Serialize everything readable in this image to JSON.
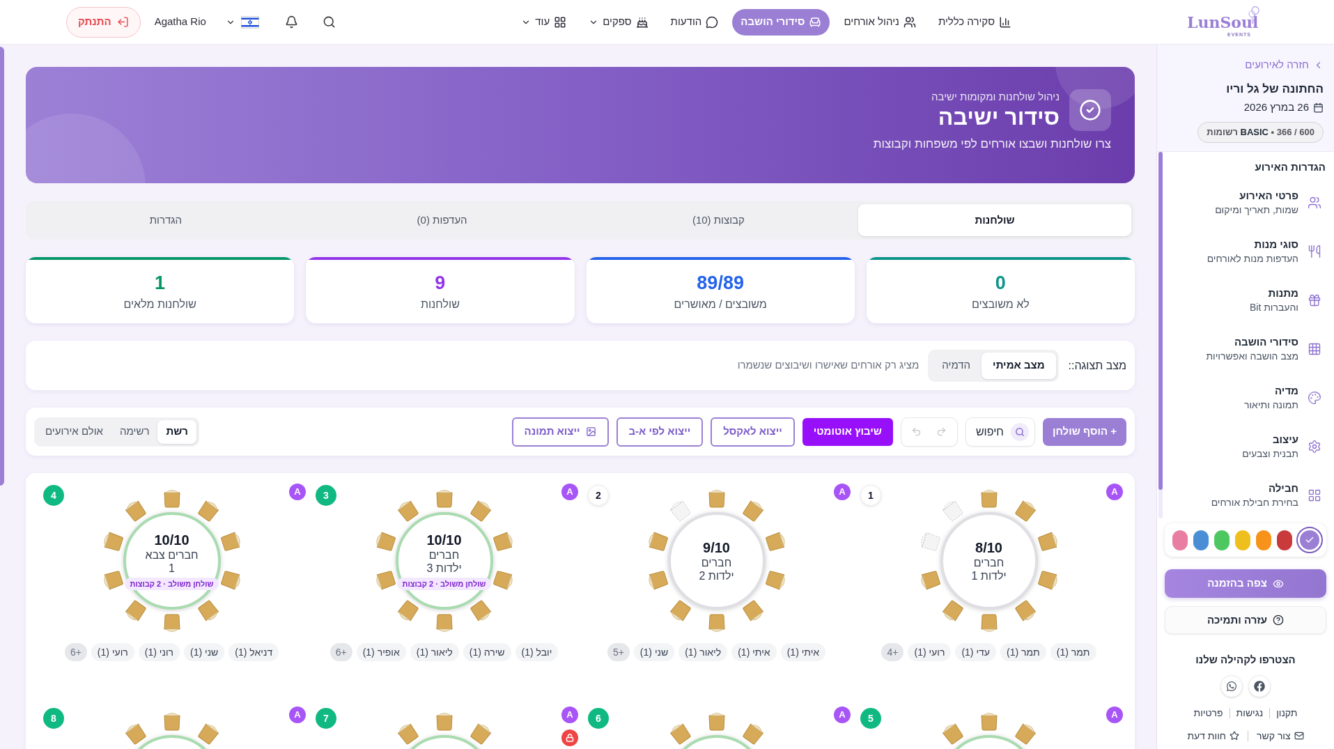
{
  "nav": {
    "logo": "LunSoul",
    "logo_tagline": "EVENTS",
    "items": [
      {
        "label": "סקירה כללית",
        "selected": false,
        "dropdown": false
      },
      {
        "label": "ניהול אורחים",
        "selected": false,
        "dropdown": false
      },
      {
        "label": "סידורי הושבה",
        "selected": true,
        "dropdown": false
      },
      {
        "label": "הודעות",
        "selected": false,
        "dropdown": false
      },
      {
        "label": "ספקים",
        "selected": false,
        "dropdown": true
      },
      {
        "label": "עוד",
        "selected": false,
        "dropdown": true
      }
    ],
    "user": "Agatha Rio",
    "logout": "התנתק"
  },
  "sidebar": {
    "back_link": "חזרה לאירועים",
    "event_title": "החתונה של גל וריו",
    "event_date": "26 במרץ 2026",
    "plan": "**BASIC** • 366 / 600 רשומות",
    "section_title": "הגדרות האירוע",
    "items": [
      {
        "title": "פרטי האירוע",
        "subtitle": "שמות, תאריך ומיקום"
      },
      {
        "title": "סוגי מנות",
        "subtitle": "העדפות מנות לאורחים"
      },
      {
        "title": "מתנות",
        "subtitle": "Bit והעברות"
      },
      {
        "title": "סידורי הושבה",
        "subtitle": "מצב הושבה ואפשרויות"
      },
      {
        "title": "מדיה",
        "subtitle": "תמונה ותיאור"
      },
      {
        "title": "עיצוב",
        "subtitle": "תבנית וצבעים"
      },
      {
        "title": "חבילה",
        "subtitle": "בחירת חבילת אורחים"
      }
    ],
    "theme_colors": [
      {
        "color": "#9b7fd4",
        "selected": true
      },
      {
        "color": "#c93a3a",
        "selected": false
      },
      {
        "color": "#f7931a",
        "selected": false
      },
      {
        "color": "#efbf1e",
        "selected": false
      },
      {
        "color": "#4fc760",
        "selected": false
      },
      {
        "color": "#4a8fd6",
        "selected": false
      },
      {
        "color": "#e87ea1",
        "selected": false
      }
    ],
    "preview_button": "צפה בהזמנה",
    "help_button": "עזרה ותמיכה",
    "community_title": "הצטרפו לקהילה שלנו",
    "links": [
      "תקנון",
      "נגישות",
      "פרטיות"
    ],
    "contact_links": [
      "צור קשר",
      "חוות דעת"
    ]
  },
  "banner": {
    "kicker": "ניהול שולחנות ומקומות ישיבה",
    "title": "סידור ישיבה",
    "description": "צרו שולחנות ושבצו אורחים לפי משפחות וקבוצות"
  },
  "tabs": [
    {
      "label": "שולחנות",
      "selected": true
    },
    {
      "label": "קבוצות (10)",
      "selected": false
    },
    {
      "label": "העדפות (0)",
      "selected": false
    },
    {
      "label": "הגדרות",
      "selected": false
    }
  ],
  "stats": [
    {
      "value": "0",
      "label": "לא משובצים",
      "color": "#0d9488"
    },
    {
      "value": "89/89",
      "label": "משובצים / מאושרים",
      "color": "#2563eb"
    },
    {
      "value": "9",
      "label": "שולחנות",
      "color": "#9333ea"
    },
    {
      "value": "1",
      "label": "שולחנות מלאים",
      "color": "#059669"
    }
  ],
  "view_mode": {
    "label": "מצב תצוגה::",
    "options": [
      {
        "label": "מצב אמיתי",
        "selected": true
      },
      {
        "label": "הדמיה",
        "selected": false
      }
    ],
    "hint": "מציג רק אורחים שאישרו ושיבוצים שנשמרו"
  },
  "toolbar": {
    "add_button": "+ הוסף שולחן",
    "search_button": "חיפוש",
    "history_buttons": [
      {
        "disabled": true
      },
      {
        "disabled": true
      }
    ],
    "auto_assign": "שיבוץ אוטומטי",
    "exports": [
      "ייצוא לאקסל",
      "ייצוא לפי א-ב",
      "ייצוא תמונה"
    ],
    "layouts": [
      {
        "label": "רשת",
        "selected": true
      },
      {
        "label": "רשימה",
        "selected": false
      },
      {
        "label": "אולם אירועים",
        "selected": false
      }
    ]
  },
  "tables": [
    {
      "number": "1",
      "full": false,
      "badge": "A",
      "locked": false,
      "seats": [
        {
          "occupied": false
        },
        {
          "occupied": true
        },
        {
          "occupied": true
        },
        {
          "occupied": true
        },
        {
          "occupied": true
        },
        {
          "occupied": true
        },
        {
          "occupied": true
        },
        {
          "occupied": true
        },
        {
          "occupied": true
        },
        {
          "occupied": false
        }
      ],
      "count": "8/10",
      "groups": [
        "חברים",
        "ילדות 1"
      ],
      "guests": [
        "תמר (1)",
        "תמר (1)",
        "עדי (1)",
        "רועי (1)"
      ],
      "more": "+4"
    },
    {
      "number": "2",
      "full": false,
      "badge": "A",
      "locked": false,
      "seats": [
        {
          "occupied": false
        },
        {
          "occupied": true
        },
        {
          "occupied": true
        },
        {
          "occupied": true
        },
        {
          "occupied": true
        },
        {
          "occupied": true
        },
        {
          "occupied": true
        },
        {
          "occupied": true
        },
        {
          "occupied": true
        },
        {
          "occupied": true
        }
      ],
      "count": "9/10",
      "groups": [
        "חברים",
        "ילדות 2"
      ],
      "guests": [
        "איתי (1)",
        "איתי (1)",
        "ליאור (1)",
        "שני (1)"
      ],
      "more": "+5"
    },
    {
      "number": "3",
      "full": true,
      "badge": "A",
      "locked": false,
      "seats": [
        {
          "occupied": true
        },
        {
          "occupied": true
        },
        {
          "occupied": true
        },
        {
          "occupied": true
        },
        {
          "occupied": true
        },
        {
          "occupied": true
        },
        {
          "occupied": true
        },
        {
          "occupied": true
        },
        {
          "occupied": true
        },
        {
          "occupied": true
        }
      ],
      "count": "10/10",
      "groups": [
        "חברים",
        "ילדות 3"
      ],
      "combined": "שולחן משולב · 2 קבוצות",
      "guests": [
        "יובל (1)",
        "שירה (1)",
        "ליאור (1)",
        "אופיר (1)"
      ],
      "more": "+6"
    },
    {
      "number": "4",
      "full": true,
      "badge": "A",
      "locked": false,
      "seats": [
        {
          "occupied": true
        },
        {
          "occupied": true
        },
        {
          "occupied": true
        },
        {
          "occupied": true
        },
        {
          "occupied": true
        },
        {
          "occupied": true
        },
        {
          "occupied": true
        },
        {
          "occupied": true
        },
        {
          "occupied": true
        },
        {
          "occupied": true
        }
      ],
      "count": "10/10",
      "groups": [
        "חברים צבא",
        "1"
      ],
      "combined": "שולחן משולב · 2 קבוצות",
      "guests": [
        "דניאל (1)",
        "שני (1)",
        "רוני (1)",
        "רועי (1)"
      ],
      "more": "+6"
    },
    {
      "number": "5",
      "full": true,
      "badge": "A",
      "locked": false,
      "seats": [
        {
          "occupied": true
        },
        {
          "occupied": true
        },
        {
          "occupied": true
        }
      ]
    },
    {
      "number": "6",
      "full": true,
      "badge": "A",
      "locked": false,
      "seats": [
        {
          "occupied": true
        },
        {
          "occupied": true
        },
        {
          "occupied": true
        }
      ]
    },
    {
      "number": "7",
      "full": true,
      "badge": "A",
      "locked": true,
      "seats": [
        {
          "occupied": true
        },
        {
          "occupied": true
        },
        {
          "occupied": true
        }
      ]
    },
    {
      "number": "8",
      "full": true,
      "badge": "A",
      "locked": false,
      "seats": [
        {
          "occupied": true
        },
        {
          "occupied": true
        },
        {
          "occupied": true
        }
      ]
    }
  ]
}
